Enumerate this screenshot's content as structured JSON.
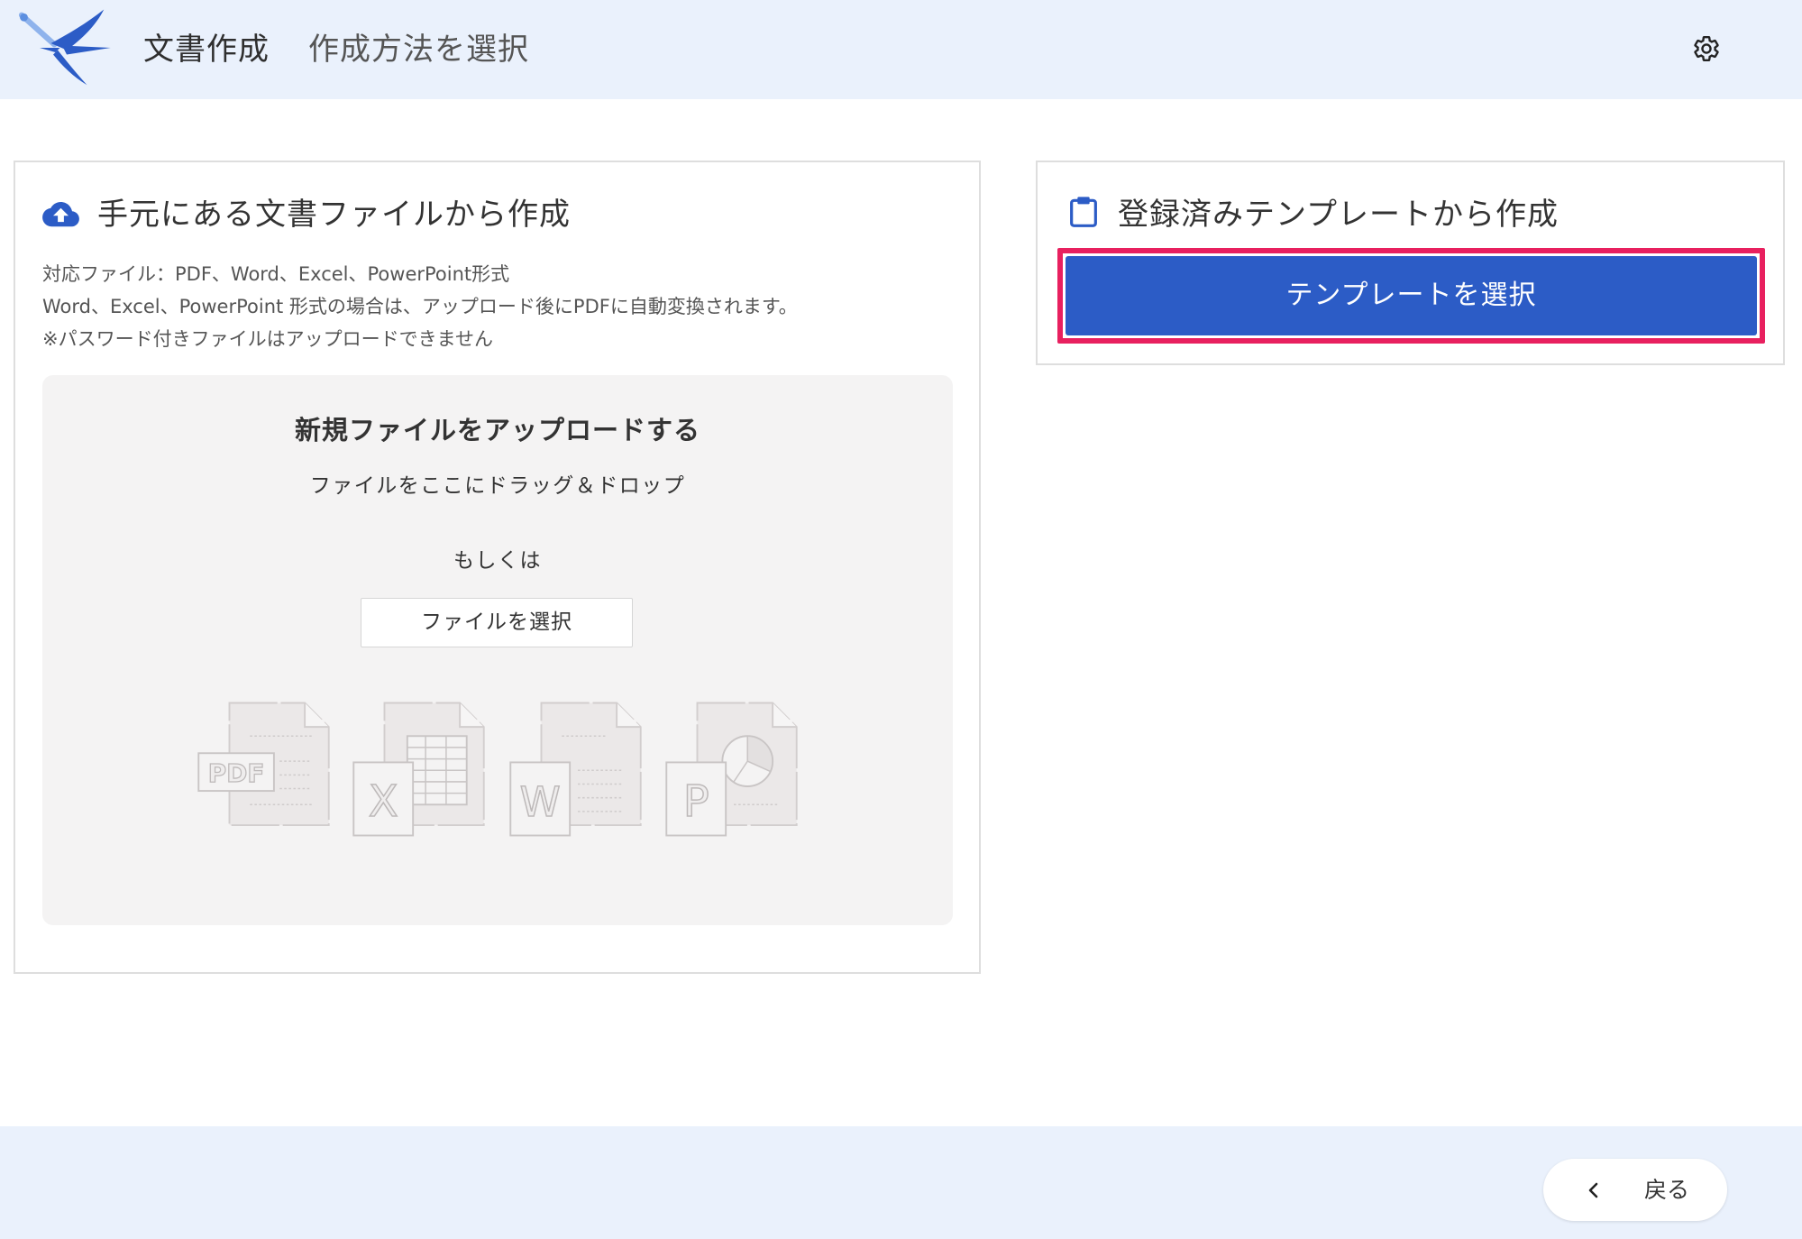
{
  "header": {
    "app_title": "文書作成",
    "page_title": "作成方法を選択"
  },
  "upload_card": {
    "title": "手元にある文書ファイルから作成",
    "notes": [
      "対応ファイル：PDF、Word、Excel、PowerPoint形式",
      "Word、Excel、PowerPoint 形式の場合は、アップロード後にPDFに自動変換されます。",
      "※パスワード付きファイルはアップロードできません"
    ],
    "dropzone": {
      "heading": "新規ファイルをアップロードする",
      "drag_text": "ファイルをここにドラッグ＆ドロップ",
      "or_text": "もしくは",
      "select_button": "ファイルを選択",
      "file_type_badges": [
        "PDF",
        "X",
        "W",
        "P"
      ]
    }
  },
  "template_card": {
    "title": "登録済みテンプレートから作成",
    "select_button": "テンプレートを選択"
  },
  "footer": {
    "back_button": "戻る"
  },
  "icons": {
    "logo": "swallow-pen-logo",
    "settings": "gear-icon",
    "upload": "cloud-upload-icon",
    "template": "clipboard-icon",
    "back": "chevron-left-icon",
    "file_types": [
      "pdf-file-icon",
      "excel-file-icon",
      "word-file-icon",
      "powerpoint-file-icon"
    ]
  },
  "colors": {
    "header_bg": "#EAF1FC",
    "primary": "#2C5CC6",
    "highlight": "#E8205F",
    "dropzone_bg": "#F4F3F3",
    "text": "#333333"
  }
}
